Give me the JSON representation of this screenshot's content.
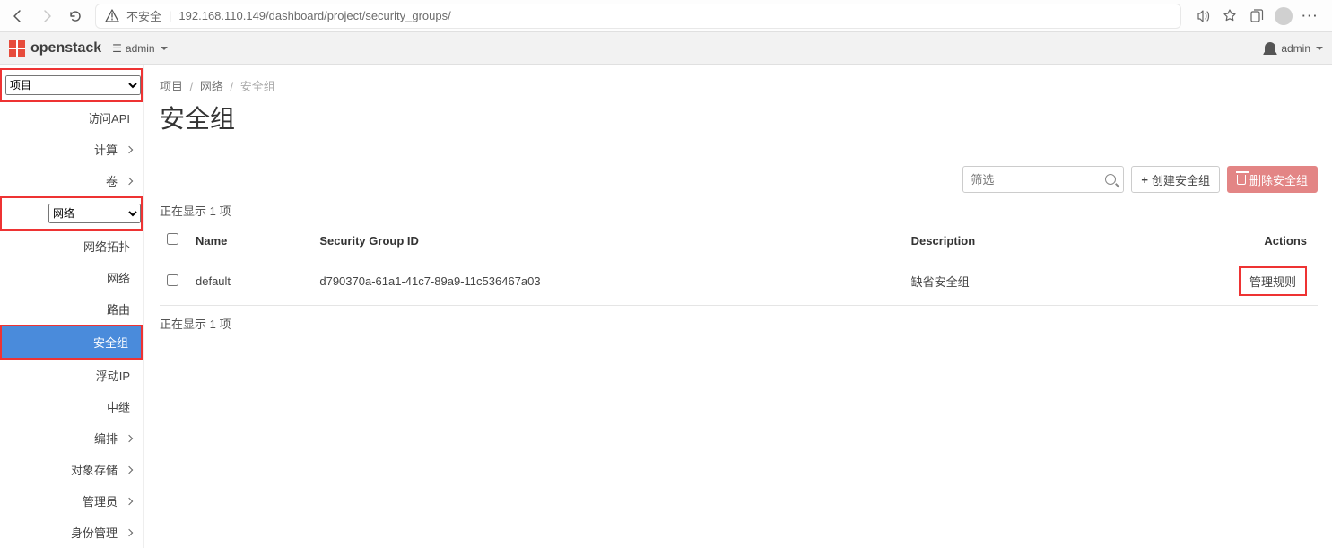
{
  "browser": {
    "insecure_label": "不安全",
    "url": "192.168.110.149/dashboard/project/security_groups/"
  },
  "topbar": {
    "brand": "openstack",
    "domain_prefix": "☰",
    "domain_label": "admin",
    "user_label": "admin"
  },
  "sidebar": {
    "project_select": "项目",
    "api_access": "访问API",
    "compute": "计算",
    "volumes": "卷",
    "network_select": "网络",
    "subitems": {
      "topology": "网络拓扑",
      "networks": "网络",
      "routers": "路由",
      "security_groups": "安全组",
      "floating_ips": "浮动IP",
      "trunks": "中继"
    },
    "orchestration": "编排",
    "object_store": "对象存储",
    "admin": "管理员",
    "identity": "身份管理"
  },
  "breadcrumb": {
    "a": "项目",
    "b": "网络",
    "c": "安全组"
  },
  "page": {
    "title": "安全组",
    "filter_placeholder": "筛选",
    "create_btn": "创建安全组",
    "delete_btn": "删除安全组",
    "showing_top": "正在显示 1 项",
    "showing_bottom": "正在显示 1 项"
  },
  "table": {
    "headers": {
      "name": "Name",
      "sgid": "Security Group ID",
      "desc": "Description",
      "actions": "Actions"
    },
    "rows": [
      {
        "name": "default",
        "sgid": "d790370a-61a1-41c7-89a9-11c536467a03",
        "desc": "缺省安全组",
        "action_label": "管理规则"
      }
    ]
  }
}
